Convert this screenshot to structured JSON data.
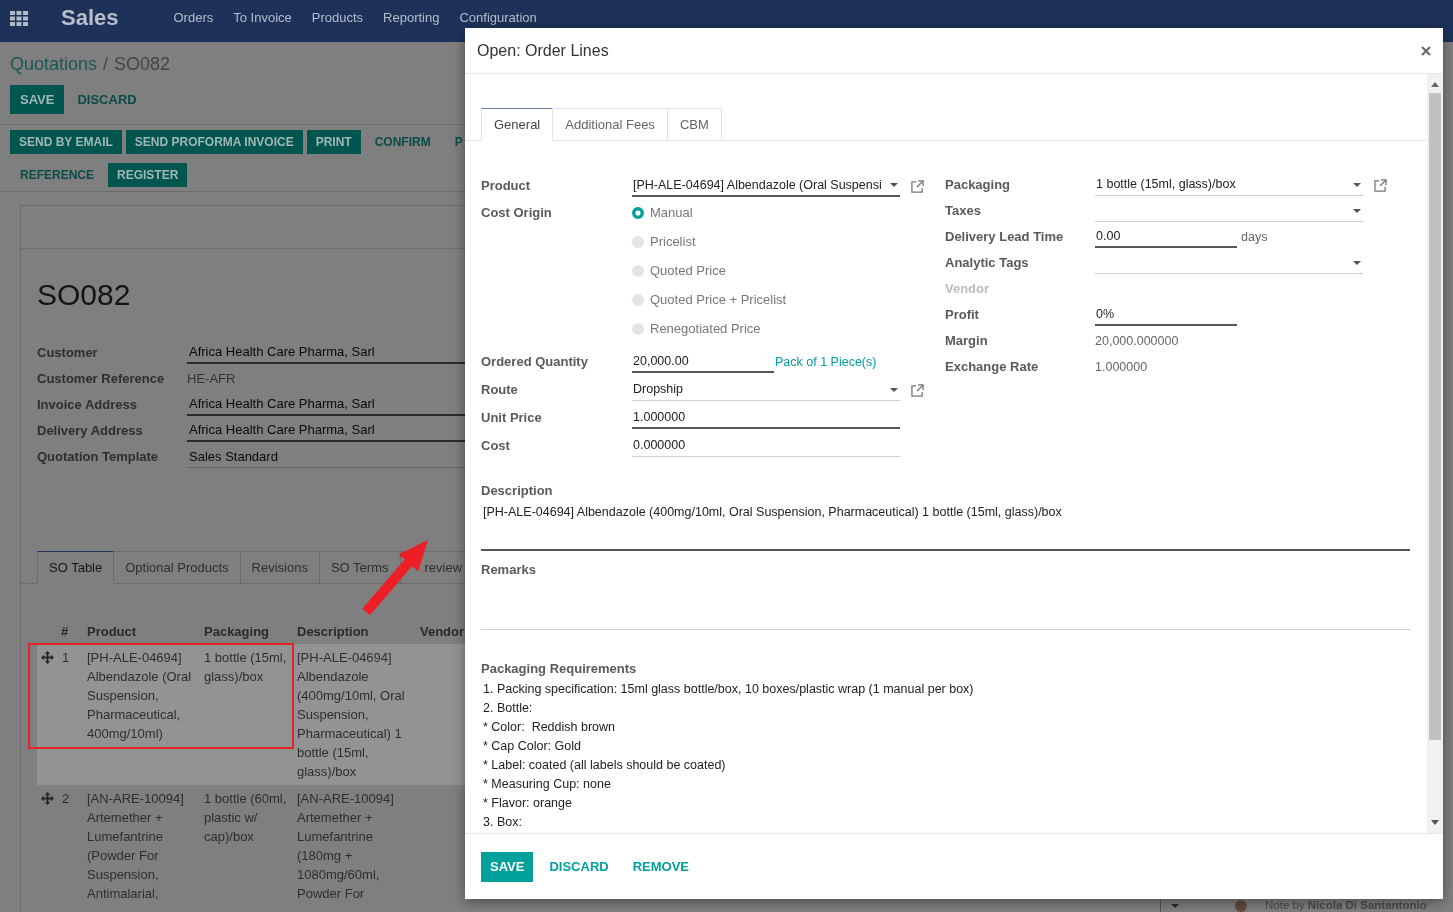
{
  "navbar": {
    "app_name": "Sales",
    "menu": [
      "Orders",
      "To Invoice",
      "Products",
      "Reporting",
      "Configuration"
    ]
  },
  "breadcrumb": {
    "parent": "Quotations",
    "separator": "/",
    "current": "SO082"
  },
  "form_buttons": [
    {
      "label": "SAVE",
      "kind": "primary"
    },
    {
      "label": "DISCARD",
      "kind": "link"
    }
  ],
  "action_rows": [
    [
      {
        "label": "SEND BY EMAIL",
        "kind": "primary"
      },
      {
        "label": "SEND PROFORMA INVOICE",
        "kind": "primary"
      },
      {
        "label": "PRINT",
        "kind": "primary"
      },
      {
        "label": "CONFIRM",
        "kind": "link"
      },
      {
        "label": "P",
        "kind": "link"
      }
    ],
    [
      {
        "label": "REFERENCE",
        "kind": "link"
      },
      {
        "label": "REGISTER",
        "kind": "primary"
      }
    ]
  ],
  "sheet": {
    "title": "SO082",
    "fields": [
      {
        "label": "Customer",
        "value": "Africa Health Care Pharma, Sarl",
        "kind": "required"
      },
      {
        "label": "Customer Reference",
        "value": "HE-AFR",
        "kind": "readonly"
      },
      {
        "label": "Invoice Address",
        "value": "Africa Health Care Pharma, Sarl",
        "kind": "required"
      },
      {
        "label": "Delivery Address",
        "value": "Africa Health Care Pharma, Sarl",
        "kind": "required"
      },
      {
        "label": "Quotation Template",
        "value": "Sales Standard",
        "kind": "optional"
      }
    ],
    "tabs": [
      {
        "label": "SO Table",
        "selected": true
      },
      {
        "label": "Optional Products",
        "selected": false
      },
      {
        "label": "Revisions",
        "selected": false
      },
      {
        "label": "SO Terms",
        "selected": false
      },
      {
        "label": "review",
        "selected": false
      }
    ],
    "table": {
      "columns": [
        "#",
        "Product",
        "Packaging",
        "Description",
        "Vendor"
      ],
      "rows": [
        {
          "selected": true,
          "number": "1",
          "product": "[PH-ALE-04694] Albendazole (Oral Suspension, Pharmaceutical, 400mg/10ml)",
          "packaging": "1 bottle (15ml, glass)/box",
          "description": "[PH-ALE-04694] Albendazole (400mg/10ml, Oral Suspension, Pharmaceutical) 1 bottle (15ml, glass)/box"
        },
        {
          "selected": false,
          "number": "2",
          "product": "[AN-ARE-10094] Artemether + Lumefantrine (Powder For Suspension, Antimalarial,",
          "packaging": "1 bottle (60ml, plastic w/ cap)/box",
          "description": "[AN-ARE-10094] Artemether + Lumefantrine (180mg + 1080mg/60ml, Powder For"
        }
      ]
    }
  },
  "chatter": {
    "note": "Note by **Nicola Di Santantonio**"
  },
  "annotations": [
    {
      "kind": "highlight_frame"
    },
    {
      "kind": "arrow"
    }
  ],
  "dialog": {
    "title": "Open: Order Lines",
    "tabs": [
      {
        "label": "General",
        "selected": true
      },
      {
        "label": "Additional Fees",
        "selected": false
      },
      {
        "label": "CBM",
        "selected": false
      }
    ],
    "left_fields": [
      {
        "label": "Product",
        "kind": "select",
        "value": "[PH-ALE-04694] Albendazole (Oral Suspensi",
        "required": true,
        "external_link": true
      },
      {
        "label": "Cost Origin",
        "kind": "radio",
        "options": [
          {
            "label": "Manual",
            "selected": true
          },
          {
            "label": "Pricelist",
            "selected": false
          },
          {
            "label": "Quoted Price",
            "selected": false
          },
          {
            "label": "Quoted Price + Pricelist",
            "selected": false
          },
          {
            "label": "Renegotiated Price",
            "selected": false
          }
        ]
      },
      {
        "label": "Ordered Quantity",
        "kind": "quantity",
        "value": "20,000.00",
        "required": true,
        "unit": {
          "text": "Pack of 1 Piece(s)",
          "kind": "link"
        }
      },
      {
        "label": "Route",
        "kind": "select",
        "value": "Dropship",
        "required": false,
        "external_link": true
      },
      {
        "label": "Unit Price",
        "kind": "input",
        "value": "1.000000",
        "required": true
      },
      {
        "label": "Cost",
        "kind": "input",
        "value": "0.000000",
        "required": false
      }
    ],
    "right_fields": [
      {
        "label": "Packaging",
        "kind": "select",
        "value": "1 bottle (15ml, glass)/box",
        "required": false,
        "external_link": true
      },
      {
        "label": "Taxes",
        "kind": "select",
        "required": false,
        "external_link": false
      },
      {
        "label": "Delivery Lead Time",
        "kind": "quantity",
        "value": "0.00",
        "required": true,
        "unit": {
          "text": "days",
          "kind": "text"
        }
      },
      {
        "label": "Analytic Tags",
        "kind": "select",
        "required": false,
        "external_link": false
      },
      {
        "label": "Vendor",
        "kind": "label"
      },
      {
        "label": "Profit",
        "kind": "percent",
        "value": "0%",
        "required": true
      },
      {
        "label": "Margin",
        "kind": "readonly",
        "value": "20,000.000000"
      },
      {
        "label": "Exchange Rate",
        "kind": "readonly",
        "value": "1.000000"
      }
    ],
    "description": {
      "label": "Description",
      "value": "[PH-ALE-04694] Albendazole (400mg/10ml, Oral Suspension, Pharmaceutical) 1 bottle (15ml, glass)/box",
      "required": true
    },
    "remarks": {
      "label": "Remarks",
      "required": false
    },
    "packaging_requirements": {
      "label": "Packaging Requirements",
      "value": "1. Packing specification: 15ml glass bottle/box, 10 boxes/plastic wrap (1 manual per box)\n2. Bottle:\n* Color:  Reddish brown\n* Cap Color: Gold\n* Label: coated (all labels should be coated)\n* Measuring Cup: none\n* Flavor: orange\n3. Box:"
    },
    "buttons": [
      {
        "label": "SAVE",
        "kind": "primary"
      },
      {
        "label": "DISCARD",
        "kind": "link"
      },
      {
        "label": "REMOVE",
        "kind": "link"
      }
    ]
  }
}
